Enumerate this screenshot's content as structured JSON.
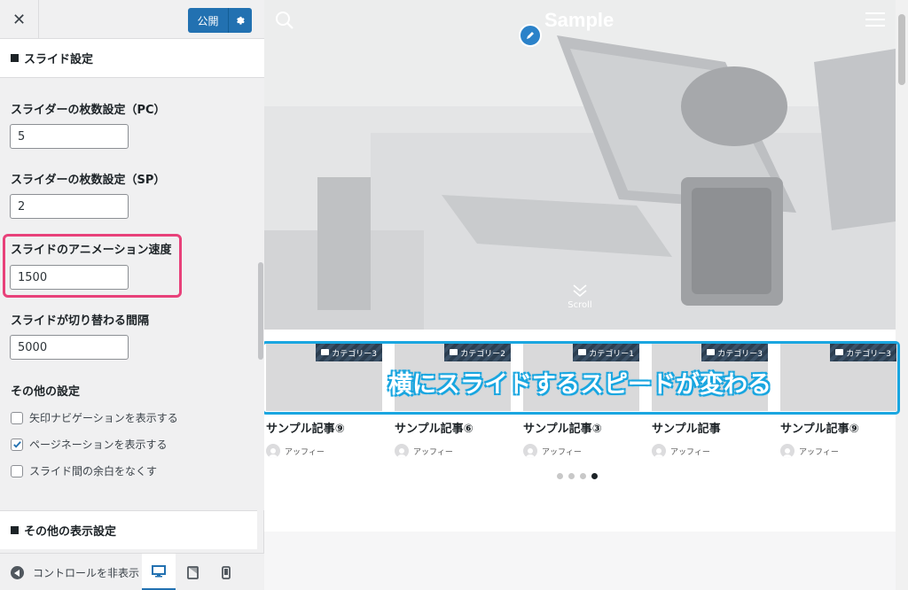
{
  "toolbar": {
    "close_label": "✕",
    "publish_label": "公開"
  },
  "section": {
    "title": "スライド設定"
  },
  "fields": [
    {
      "label": "スライダーの枚数設定（PC）",
      "value": "5"
    },
    {
      "label": "スライダーの枚数設定（SP）",
      "value": "2"
    },
    {
      "label": "スライドのアニメーション速度",
      "value": "1500"
    },
    {
      "label": "スライドが切り替わる間隔",
      "value": "5000"
    }
  ],
  "other": {
    "title": "その他の設定",
    "checkboxes": [
      {
        "label": "矢印ナビゲーションを表示する",
        "checked": false
      },
      {
        "label": "ページネーションを表示する",
        "checked": true
      },
      {
        "label": "スライド間の余白をなくす",
        "checked": false
      }
    ]
  },
  "section2": {
    "title": "その他の表示設定"
  },
  "footer": {
    "hide_controls_label": "コントロールを非表示"
  },
  "colors": {
    "accent": "#2271b1",
    "highlight_pink": "#e8417a",
    "highlight_blue": "#1aa6e0"
  },
  "preview": {
    "site_title": "Sample",
    "scroll_label": "Scroll",
    "callout": "横にスライドするスピードが変わる",
    "cards": [
      {
        "category": "カテゴリー3",
        "title": "サンプル記事⑨",
        "author": "アッフィー"
      },
      {
        "category": "カテゴリー2",
        "title": "サンプル記事⑥",
        "author": "アッフィー"
      },
      {
        "category": "カテゴリー1",
        "title": "サンプル記事③",
        "author": "アッフィー"
      },
      {
        "category": "カテゴリー3",
        "title": "サンプル記事",
        "author": "アッフィー"
      },
      {
        "category": "カテゴリー3",
        "title": "サンプル記事⑨",
        "author": "アッフィー"
      }
    ]
  }
}
